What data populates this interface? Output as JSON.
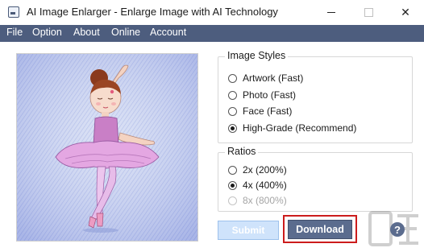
{
  "window": {
    "title": "AI Image Enlarger - Enlarge Image with AI Technology",
    "minimize_glyph": "–",
    "maximize_glyph": "☐",
    "close_glyph": "✕"
  },
  "menu": [
    {
      "label": "File"
    },
    {
      "label": "Option"
    },
    {
      "label": "About"
    },
    {
      "label": "Online"
    },
    {
      "label": "Account"
    }
  ],
  "image_styles": {
    "title": "Image Styles",
    "options": [
      {
        "label": "Artwork (Fast)",
        "checked": false
      },
      {
        "label": "Photo (Fast)",
        "checked": false
      },
      {
        "label": "Face (Fast)",
        "checked": false
      },
      {
        "label": "High-Grade (Recommend)",
        "checked": true
      }
    ]
  },
  "ratios": {
    "title": "Ratios",
    "options": [
      {
        "label": "2x (200%)",
        "checked": false,
        "disabled": false
      },
      {
        "label": "4x (400%)",
        "checked": true,
        "disabled": false
      },
      {
        "label": "8x (800%)",
        "checked": false,
        "disabled": true
      }
    ]
  },
  "buttons": {
    "submit": "Submit",
    "download": "Download",
    "help": "?"
  },
  "preview": {
    "subject_icon": "ballerina-illustration"
  },
  "colors": {
    "menubar": "#4d5d7e",
    "download_button": "#5b6c8e",
    "submit_button": "#cfe3fb",
    "highlight_border": "#cc1c1c"
  }
}
